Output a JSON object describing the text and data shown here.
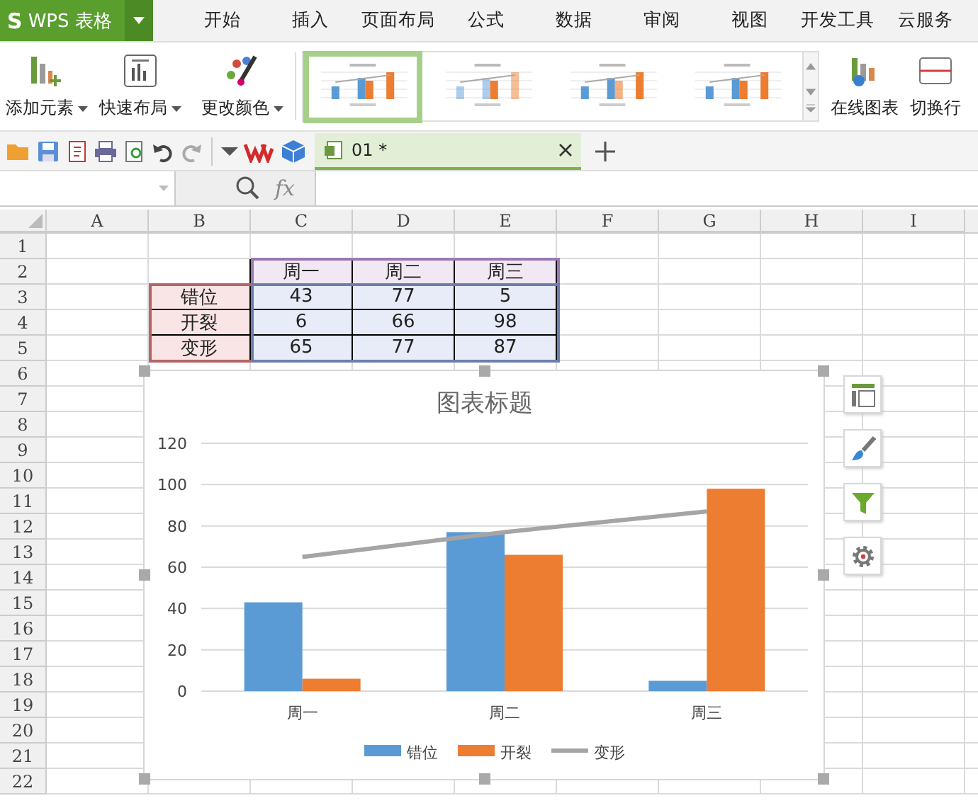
{
  "app_button": {
    "logo": "S",
    "label": "WPS 表格"
  },
  "menu_tabs": [
    {
      "label": "开始"
    },
    {
      "label": "插入"
    },
    {
      "label": "页面布局"
    },
    {
      "label": "公式"
    },
    {
      "label": "数据"
    },
    {
      "label": "审阅"
    },
    {
      "label": "视图"
    },
    {
      "label": "开发工具"
    },
    {
      "label": "云服务"
    }
  ],
  "ribbon": {
    "left_tools": [
      {
        "kind": "add-element",
        "label": "添加元素",
        "dropdown": true
      },
      {
        "kind": "layout",
        "label": "快速布局",
        "dropdown": true
      },
      {
        "kind": "color",
        "label": "更改颜色",
        "dropdown": true
      }
    ],
    "styles": [
      {
        "selected": true
      },
      {
        "selected": false
      },
      {
        "selected": false
      },
      {
        "selected": false
      }
    ],
    "right_tools": [
      {
        "kind": "online-chart",
        "label": "在线图表",
        "dropdown": false
      },
      {
        "kind": "switch-row",
        "label": "切换行",
        "dropdown": false
      }
    ]
  },
  "doc_tab": {
    "title": "01 *"
  },
  "formula_bar": {
    "fx": "fx"
  },
  "sheet": {
    "columns": [
      "A",
      "B",
      "C",
      "D",
      "E",
      "F",
      "G",
      "H",
      "I"
    ],
    "rows": [
      "1",
      "2",
      "3",
      "4",
      "5",
      "6",
      "7",
      "8",
      "9",
      "10",
      "11",
      "12",
      "13",
      "14",
      "15",
      "16",
      "17",
      "18",
      "19",
      "20",
      "21",
      "22"
    ],
    "table": {
      "header": [
        "周一",
        "周二",
        "周三"
      ],
      "rows": [
        {
          "label": "错位",
          "values": [
            "43",
            "77",
            "5"
          ]
        },
        {
          "label": "开裂",
          "values": [
            "6",
            "66",
            "98"
          ]
        },
        {
          "label": "变形",
          "values": [
            "65",
            "77",
            "87"
          ]
        }
      ]
    }
  },
  "chart": {
    "chart_data": {
      "type": "bar",
      "title": "图表标题",
      "categories": [
        "周一",
        "周二",
        "周三"
      ],
      "series": [
        {
          "name": "错位",
          "color": "#5b9bd5",
          "values": [
            43,
            77,
            5
          ]
        },
        {
          "name": "开裂",
          "color": "#ed7d31",
          "values": [
            6,
            66,
            98
          ]
        },
        {
          "name": "变形",
          "color": "#a5a5a5",
          "type": "line",
          "values": [
            65,
            77,
            87
          ]
        }
      ],
      "grid": true,
      "legend": true,
      "ylim": [
        0,
        120
      ],
      "yticks": [
        0,
        20,
        40,
        60,
        80,
        100,
        120
      ]
    }
  }
}
